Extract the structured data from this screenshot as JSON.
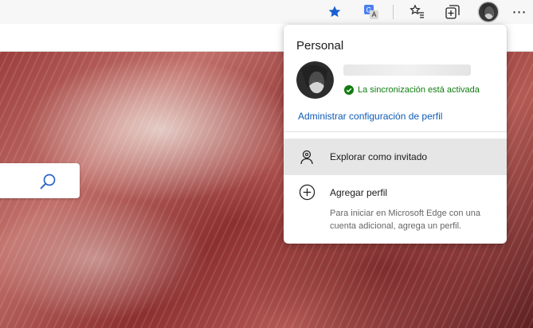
{
  "colors": {
    "accent_blue": "#0f5bb5",
    "sync_green": "#107c10",
    "star_blue": "#1a5fd4"
  },
  "toolbar": {
    "favorite_icon": "star-filled-icon",
    "translate_icon": "translate-icon",
    "favorites_icon": "favorites-list-icon",
    "collections_icon": "collections-icon",
    "profile_icon": "profile-avatar",
    "more_label": "⋯"
  },
  "search": {
    "placeholder": "",
    "icon": "search-icon"
  },
  "profile_menu": {
    "title": "Personal",
    "sync_status": "La sincronización está activada",
    "manage_link": "Administrar configuración de perfil",
    "guest": {
      "label": "Explorar como invitado",
      "icon": "guest-person-icon"
    },
    "add_profile": {
      "label": "Agregar perfil",
      "icon": "add-circle-icon",
      "description": "Para iniciar en Microsoft Edge con una cuenta adicional, agrega un perfil."
    }
  }
}
